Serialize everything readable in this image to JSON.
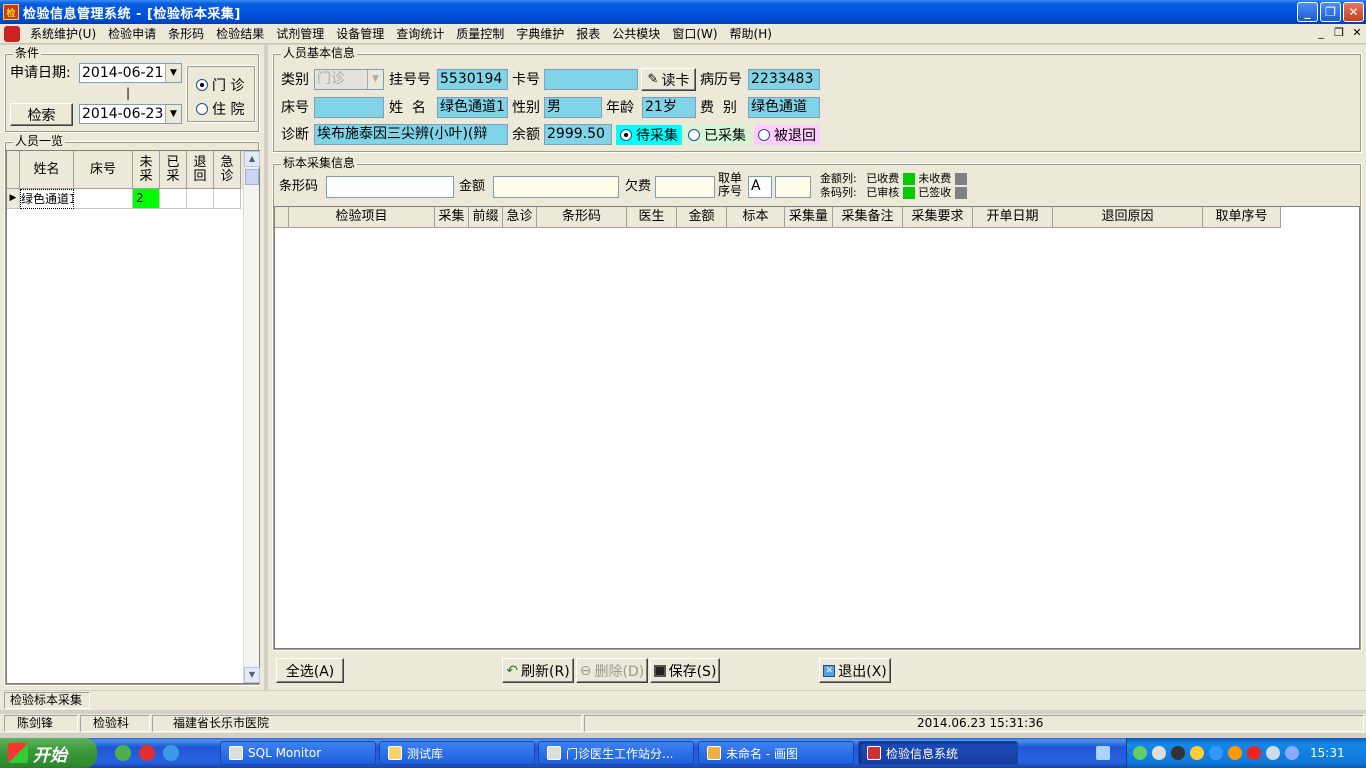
{
  "window": {
    "title": "检验信息管理系统 - [检验标本采集]",
    "app_icon": "lab-app-icon",
    "buttons": [
      "_",
      "❐",
      "✕"
    ]
  },
  "menu": {
    "items": [
      "系统维护(U)",
      "检验申请",
      "条形码",
      "检验结果",
      "试剂管理",
      "设备管理",
      "查询统计",
      "质量控制",
      "字典维护",
      "报表",
      "公共模块",
      "窗口(W)",
      "帮助(H)"
    ],
    "mdi_buttons": [
      "_",
      "❐",
      "✕"
    ]
  },
  "conditions": {
    "group_title": "条件",
    "date_label": "申请日期:",
    "date_from": "2014-06-21",
    "date_to": "2014-06-23",
    "range_separator": "|",
    "search_button": "检索",
    "radio_outpatient": "门 诊",
    "radio_inpatient": "住 院"
  },
  "person_list": {
    "group_title": "人员一览",
    "columns": [
      "姓名",
      "床号",
      "未采",
      "已采",
      "退回",
      "急诊"
    ],
    "rows": [
      {
        "name": "绿色通道1",
        "bed": "",
        "not_collected": "2",
        "collected": "",
        "returned": "",
        "urgent": ""
      }
    ],
    "highlight_color": "#00ff00"
  },
  "basic_info": {
    "group_title": "人员基本信息",
    "type_label": "类别",
    "type_value": "门诊",
    "reg_no_label": "挂号号",
    "reg_no_value": "5530194",
    "card_no_label": "卡号",
    "card_no_value": "",
    "read_card_button": "读卡",
    "record_no_label": "病历号",
    "record_no_value": "2233483",
    "bed_label": "床号",
    "bed_value": "",
    "name_label": "姓  名",
    "name_value": "绿色通道1",
    "sex_label": "性别",
    "sex_value": "男",
    "age_label": "年龄",
    "age_value": "21岁",
    "fee_label": "费  别",
    "fee_value": "绿色通道",
    "diag_label": "诊断",
    "diag_value": "埃布施泰因三尖辨(小叶)(辩",
    "balance_label": "余额",
    "balance_value": "2999.50",
    "status_pending": "待采集",
    "status_collected": "已采集",
    "status_returned": "被退回",
    "field_color": "#80d4e8"
  },
  "sample_info": {
    "group_title": "标本采集信息",
    "barcode_label": "条形码",
    "barcode_value": "",
    "amount_label": "金额",
    "amount_value": "",
    "owe_label": "欠费",
    "owe_value": "",
    "order_no_label_1": "取单",
    "order_no_label_2": "序号",
    "order_prefix": "A",
    "order_no_value": "",
    "legend_amount_col": "金额列:",
    "legend_paid": "已收费",
    "legend_unpaid": "未收费",
    "legend_barcode_col": "条码列:",
    "legend_audited": "已审核",
    "legend_signed": "已签收",
    "color_green": "#00cc00",
    "color_gray": "#808080"
  },
  "sample_grid": {
    "columns": [
      "",
      "检验项目",
      "采集",
      "前缀",
      "急诊",
      "条形码",
      "医生",
      "金额",
      "标本",
      "采集量",
      "采集备注",
      "采集要求",
      "开单日期",
      "退回原因",
      "取单序号"
    ]
  },
  "actions": {
    "select_all": "全选(A)",
    "refresh": "刷新(R)",
    "delete": "删除(D)",
    "save": "保存(S)",
    "exit": "退出(X)"
  },
  "mdi_tab": "检验标本采集",
  "status": {
    "user": "陈剑锋",
    "dept": "检验科",
    "hospital": "福建省长乐市医院",
    "datetime": "2014.06.23 15:31:36"
  },
  "taskbar": {
    "start": "开始",
    "tasks": [
      "SQL Monitor",
      "测试库",
      "门诊医生工作站分...",
      "未命名 - 画图",
      "检验信息系统"
    ],
    "clock": "15:31"
  }
}
